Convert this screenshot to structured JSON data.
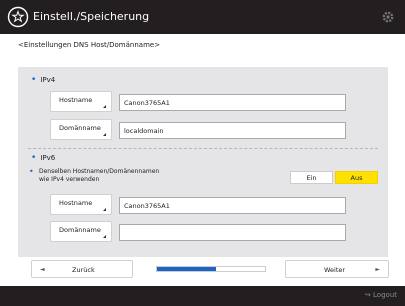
{
  "header": {
    "title": "Einstell./Speicherung"
  },
  "breadcrumb": "<Einstellungen DNS Host/Domänname>",
  "ipv4": {
    "section_label": "IPv4",
    "hostname_label": "Hostname",
    "hostname_value": "Canon3765A1",
    "domain_label": "Domänname",
    "domain_value": "localdomain"
  },
  "ipv6": {
    "section_label": "IPv6",
    "same_option_line1": "Denselben Hostnamen/Domänennamen",
    "same_option_line2": "wie IPv4 verwenden",
    "toggle_on_label": "Ein",
    "toggle_off_label": "Aus",
    "selected": "Aus",
    "hostname_label": "Hostname",
    "hostname_value": "Canon3765A1",
    "domain_label": "Domänname",
    "domain_value": ""
  },
  "nav": {
    "back_label": "Zurück",
    "next_label": "Weiter",
    "progress_fraction": 0.55
  },
  "footer": {
    "logout_label": "Logout"
  },
  "colors": {
    "accent": "#1d63c8",
    "selected_toggle": "#ffe000",
    "bar": "#231f20"
  },
  "icons": [
    "home-icon",
    "settings-gear-icon",
    "left-arrow-icon",
    "right-arrow-icon",
    "logout-icon"
  ]
}
